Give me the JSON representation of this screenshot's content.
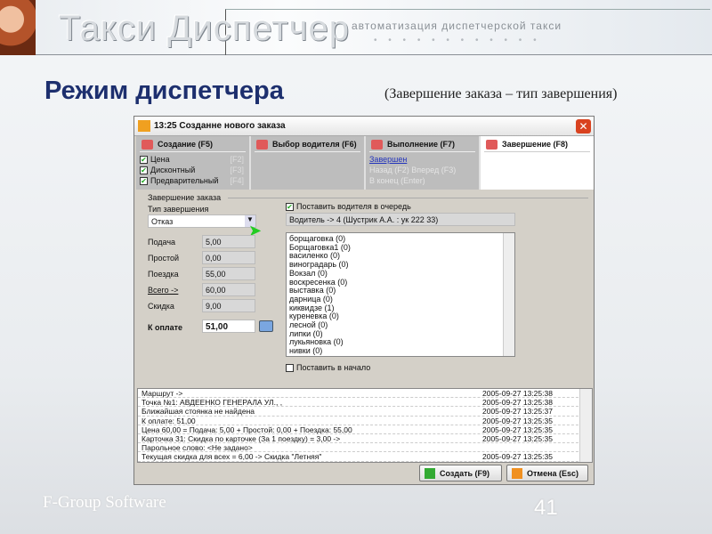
{
  "banner": {
    "logo": "Такси Диспетчер",
    "tagline": "автоматизация диспетчерской такси"
  },
  "slide": {
    "title": "Режим диспетчера",
    "subtitle": "(Завершение заказа – тип завершения)",
    "footer": "F-Group Software",
    "page": "41"
  },
  "dialog": {
    "title": "13:25 Созданне нового заказа",
    "tabs": [
      {
        "label": "Создание (F5)",
        "items": [
          {
            "label": "Цена",
            "key": "[F2]",
            "checked": true
          },
          {
            "label": "Дисконтный",
            "key": "[F3]",
            "checked": true
          },
          {
            "label": "Предварительный",
            "key": "[F4]",
            "checked": true
          }
        ]
      },
      {
        "label": "Выбор водителя (F6)"
      },
      {
        "label": "Выполнение (F7)",
        "link": "Завершен",
        "nav1": "Назад (F2)  Вперед (F3)",
        "nav2": "В конец (Enter)"
      },
      {
        "label": "Завершение (F8)"
      }
    ],
    "group_label": "Завершение заказа",
    "completion_type_label": "Тип завершения",
    "completion_type": "Отказ",
    "fields": [
      {
        "label": "Подача",
        "value": "5,00"
      },
      {
        "label": "Простой",
        "value": "0,00"
      },
      {
        "label": "Поездка",
        "value": "55,00"
      },
      {
        "label": "Всего ->",
        "value": "60,00"
      },
      {
        "label": "Скидка",
        "value": "9,00"
      }
    ],
    "to_pay_label": "К оплате",
    "to_pay": "51,00",
    "queue_label": "Поставить водителя в очередь",
    "queue_checked": true,
    "driver": "Водитель -> 4 (Шустрик А.А. : ук 222 33)",
    "stands": [
      "борщаговка (0)",
      "Борщаговка1 (0)",
      "василенко (0)",
      "виноградарь (0)",
      "Вокзал (0)",
      "воскресенка (0)",
      "выставка (0)",
      "дарница (0)",
      "киквидзе (1)",
      "куреневка (0)",
      "лесной (0)",
      "липки (0)",
      "лукьяновка (0)",
      "нивки (0)"
    ],
    "start_label": "Поставить в начало",
    "log": [
      [
        "Маршрут ->",
        "2005-09-27 13:25:38"
      ],
      [
        "Точка №1: АВДЕЕНКО ГЕНЕРАЛА УЛ., ,",
        "2005-09-27 13:25:38"
      ],
      [
        "Ближайшая стоянка не найдена",
        "2005-09-27 13:25:37"
      ],
      [
        "К оплате: 51,00",
        "2005-09-27 13:25:35"
      ],
      [
        "Цена 60,00 = Подача: 5,00 + Простой: 0,00 + Поездка: 55,00",
        "2005-09-27 13:25:35"
      ],
      [
        "Карточка 31: Скидка по карточке (За 1 поездку) = 3,00 ->",
        "2005-09-27 13:25:35"
      ],
      [
        "Парольное слово: <Не задано>",
        ""
      ],
      [
        "Текущая скидка для всех = 6,00 -> Скидка \"Летняя\"",
        "2005-09-27 13:25:35"
      ]
    ],
    "create_btn": "Создать (F9)",
    "cancel_btn": "Отмена (Esc)"
  }
}
